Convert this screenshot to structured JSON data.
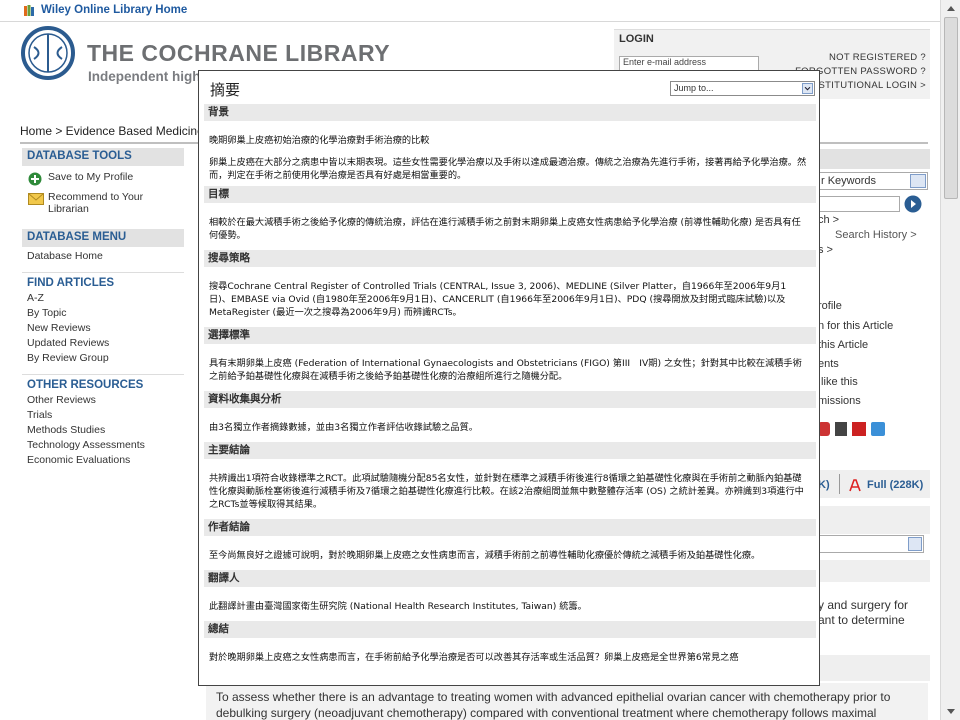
{
  "top_bar": {
    "link_label": "Wiley Online Library Home"
  },
  "header": {
    "title": "THE COCHRANE LIBRARY",
    "subtitle": "Independent high-"
  },
  "login": {
    "title": "LOGIN",
    "email_placeholder": "Enter e-mail address",
    "links": [
      "NOT REGISTERED ?",
      "FORGOTTEN PASSWORD ?",
      "INSTITUTIONAL LOGIN >"
    ]
  },
  "breadcrumb": "Home >  Evidence Based Medicine",
  "sidebar": {
    "database_tools": {
      "title": "DATABASE TOOLS",
      "save": "Save to My Profile",
      "recommend_line1": "Recommend to Your",
      "recommend_line2": "Librarian"
    },
    "database_menu": {
      "title": "DATABASE MENU",
      "items": [
        "Database Home"
      ]
    },
    "find_articles": {
      "title": "FIND ARTICLES",
      "items": [
        "A-Z",
        "By Topic",
        "New Reviews",
        "Updated Reviews",
        "By Review Group"
      ]
    },
    "other_resources": {
      "title": "OTHER RESOURCES",
      "items": [
        "Other Reviews",
        "Trials",
        "Methods Studies",
        "Technology Assessments",
        "Economic Evaluations"
      ]
    }
  },
  "right_column": {
    "keywords_select": "r Keywords",
    "search_link": "ch >",
    "search_history": "Search History >",
    "s_link": "s >",
    "profile": "rofile",
    "alert": "n for this Article",
    "article": "this Article",
    "ents": "ents",
    "like": " like this",
    "missions": "missions",
    "pdf_small": "K)",
    "pdf_full": "Full (228K)",
    "text_a": "y and surgery for",
    "text_b": "ant to determine"
  },
  "underlying_abstract": "To assess whether there is an advantage to treating women with advanced epithelial ovarian cancer with chemotherapy prior to debulking surgery (neoadjuvant chemotherapy) compared with conventional treatment where chemotherapy follows maximal debulking surgery.",
  "popup": {
    "title": "摘要",
    "jump_to": "Jump to...",
    "sections": [
      {
        "heading": "背景",
        "paragraphs": [
          "晚期卵巢上皮癌初始治療的化學治療對手術治療的比較",
          "卵巢上皮癌在大部分之病患中皆以末期表現。這些女性需要化學治療以及手術以達成最適治療。傳統之治療為先進行手術，接著再給予化學治療。然而，判定在手術之前使用化學治療是否具有好處是相當重要的。"
        ]
      },
      {
        "heading": "目標",
        "paragraphs": [
          "相較於在最大減積手術之後給予化療的傳統治療，評估在進行減積手術之前對末期卵巢上皮癌女性病患給予化學治療 (前導性輔助化療) 是否具有任何優勢。"
        ]
      },
      {
        "heading": "搜尋策略",
        "paragraphs": [
          "搜尋Cochrane Central Register of Controlled Trials (CENTRAL, Issue 3, 2006)、MEDLINE (Silver Platter，自1966年至2006年9月1日)、EMBASE via Ovid (自1980年至2006年9月1日)、CANCERLIT (自1966年至2006年9月1日)、PDQ (搜尋開放及封閉式臨床試驗)以及MetaRegister (最近一次之搜尋為2006年9月) 而辨識RCTs。"
        ]
      },
      {
        "heading": "選擇標準",
        "paragraphs": [
          "具有末期卵巢上皮癌 (Federation of International Gynaecologists and Obstetricians (FIGO) 第III　IV期) 之女性；針對其中比較在減積手術之前給予鉑基礎性化療與在減積手術之後給予鉑基礎性化療的治療組所進行之隨機分配。"
        ]
      },
      {
        "heading": "資料收集與分析",
        "paragraphs": [
          "由3名獨立作者摘錄數據，並由3名獨立作者評估收錄試驗之品質。"
        ]
      },
      {
        "heading": "主要結論",
        "paragraphs": [
          "共辨識出1項符合收錄標準之RCT。此項試驗隨機分配85名女性，並針對在標準之減積手術後進行8循環之鉑基礎性化療與在手術前之動脈內鉑基礎性化療與動脈栓塞術後進行減積手術及7循環之鉑基礎性化療進行比較。在該2治療組間並無中數整體存活率 (OS) 之統計差異。亦辨識到3項進行中之RCTs並等候取得其結果。"
        ]
      },
      {
        "heading": "作者結論",
        "paragraphs": [
          "至今尚無良好之證據可說明，對於晚期卵巢上皮癌之女性病患而言，減積手術前之前導性輔助化療優於傳統之減積手術及鉑基礎性化療。"
        ]
      },
      {
        "heading": "翻譯人",
        "paragraphs": [
          "此翻譯計畫由臺灣國家衛生研究院 (National Health Research Institutes, Taiwan) 統籌。"
        ]
      },
      {
        "heading": "總結",
        "paragraphs": [
          "對於晚期卵巢上皮癌之女性病患而言，在手術前給予化學治療是否可以改善其存活率或生活品質？卵巢上皮癌是全世界第6常見之癌"
        ]
      }
    ]
  },
  "colors": {
    "brand_blue": "#2a5d93",
    "logo_gray": "#6d6f72",
    "popup_border": "#444444"
  }
}
